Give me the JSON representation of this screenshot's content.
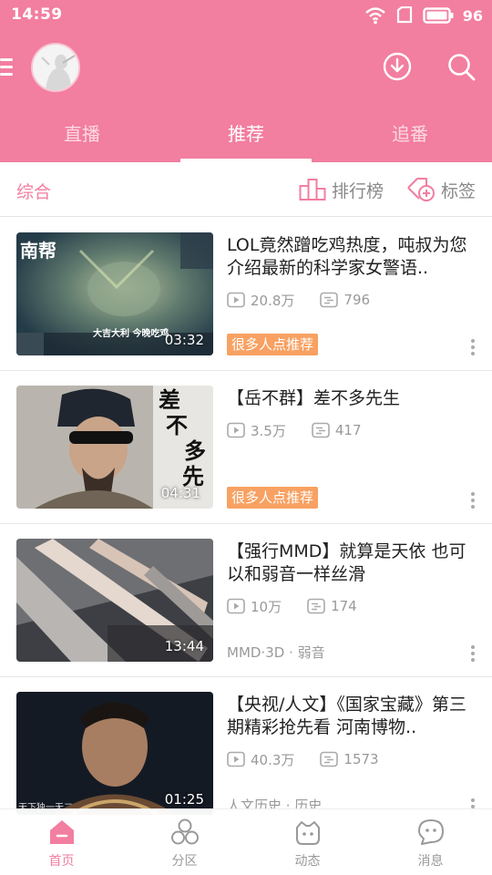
{
  "status": {
    "time": "14:59",
    "battery": "96"
  },
  "header": {
    "tabs": [
      {
        "label": "直播"
      },
      {
        "label": "推荐"
      },
      {
        "label": "追番"
      }
    ],
    "active_tab": 1
  },
  "filter": {
    "label": "综合",
    "rank_label": "排行榜",
    "tag_label": "标签"
  },
  "videos": [
    {
      "title": "LOL竟然蹭吃鸡热度，吨叔为您介绍最新的科学家女警语..",
      "views": "20.8万",
      "danmaku": "796",
      "duration": "03:32",
      "badge": "很多人点推荐",
      "thumb_caption": "大吉大利 今晚吃鸡",
      "thumb_logo": "南帮"
    },
    {
      "title": "【岳不群】差不多先生",
      "views": "3.5万",
      "danmaku": "417",
      "duration": "04:31",
      "badge": "很多人点推荐",
      "thumb_text": [
        "差",
        "不",
        "多",
        "先",
        "生"
      ]
    },
    {
      "title": "【强行MMD】就算是天依 也可以和弱音一样丝滑",
      "views": "10万",
      "danmaku": "174",
      "duration": "13:44",
      "category": "MMD·3D · 弱音"
    },
    {
      "title": "【央视/人文】《国家宝藏》第三期精彩抢先看 河南博物..",
      "views": "40.3万",
      "danmaku": "1573",
      "duration": "01:25",
      "category": "人文历史 · 历史",
      "thumb_caption": "天下独一无二"
    }
  ],
  "bottom_nav": [
    {
      "label": "首页",
      "icon": "home-icon"
    },
    {
      "label": "分区",
      "icon": "category-icon"
    },
    {
      "label": "动态",
      "icon": "dynamic-icon"
    },
    {
      "label": "消息",
      "icon": "message-icon"
    }
  ],
  "colors": {
    "brand": "#f27ea0",
    "badge": "#f8a162",
    "text_gray": "#999999"
  }
}
